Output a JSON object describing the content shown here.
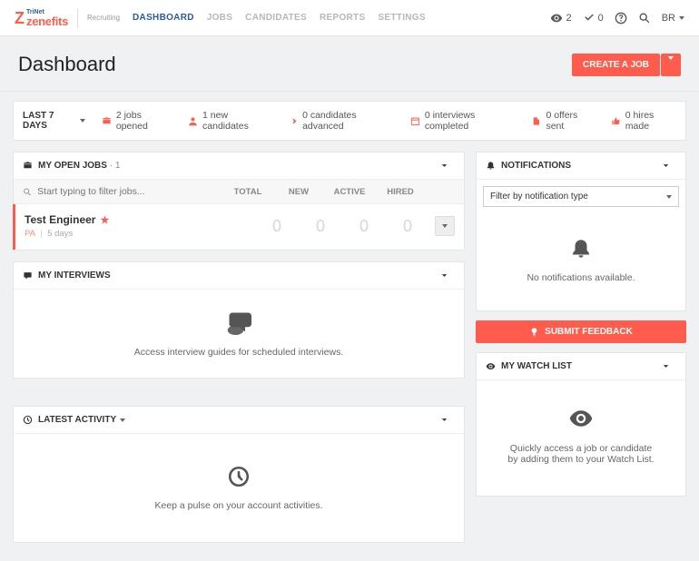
{
  "top": {
    "logo": {
      "trinet": "TriNet",
      "zenefits": "zenefits",
      "recruiting": "Recruiting"
    },
    "nav": [
      "DASHBOARD",
      "JOBS",
      "CANDIDATES",
      "REPORTS",
      "SETTINGS"
    ],
    "views_count": "2",
    "checks_count": "0",
    "user": "BR"
  },
  "title": "Dashboard",
  "create_job": "CREATE A JOB",
  "range_label": "LAST 7 DAYS",
  "stats": {
    "jobs_opened": "2 jobs opened",
    "new_candidates": "1 new candidates",
    "candidates_advanced": "0 candidates advanced",
    "interviews_completed": "0 interviews completed",
    "offers_sent": "0 offers sent",
    "hires_made": "0 hires made"
  },
  "open_jobs": {
    "header": "MY OPEN JOBS",
    "count": "1",
    "filter_placeholder": "Start typing to filter jobs...",
    "cols": {
      "total": "TOTAL",
      "new": "NEW",
      "active": "ACTIVE",
      "hired": "HIRED"
    },
    "job": {
      "title": "Test Engineer",
      "location": "PA",
      "age": "5 days",
      "total": "0",
      "new": "0",
      "active": "0",
      "hired": "0"
    }
  },
  "interviews": {
    "header": "MY INTERVIEWS",
    "empty": "Access interview guides for scheduled interviews."
  },
  "latest_activity": {
    "header": "LATEST ACTIVITY",
    "empty": "Keep a pulse on your account activities."
  },
  "notifications": {
    "header": "NOTIFICATIONS",
    "filter_label": "Filter by notification type",
    "empty": "No notifications available."
  },
  "feedback_label": "SUBMIT FEEDBACK",
  "watchlist": {
    "header": "MY WATCH LIST",
    "empty_line1": "Quickly access a job or candidate",
    "empty_line2": "by adding them to your Watch List."
  }
}
